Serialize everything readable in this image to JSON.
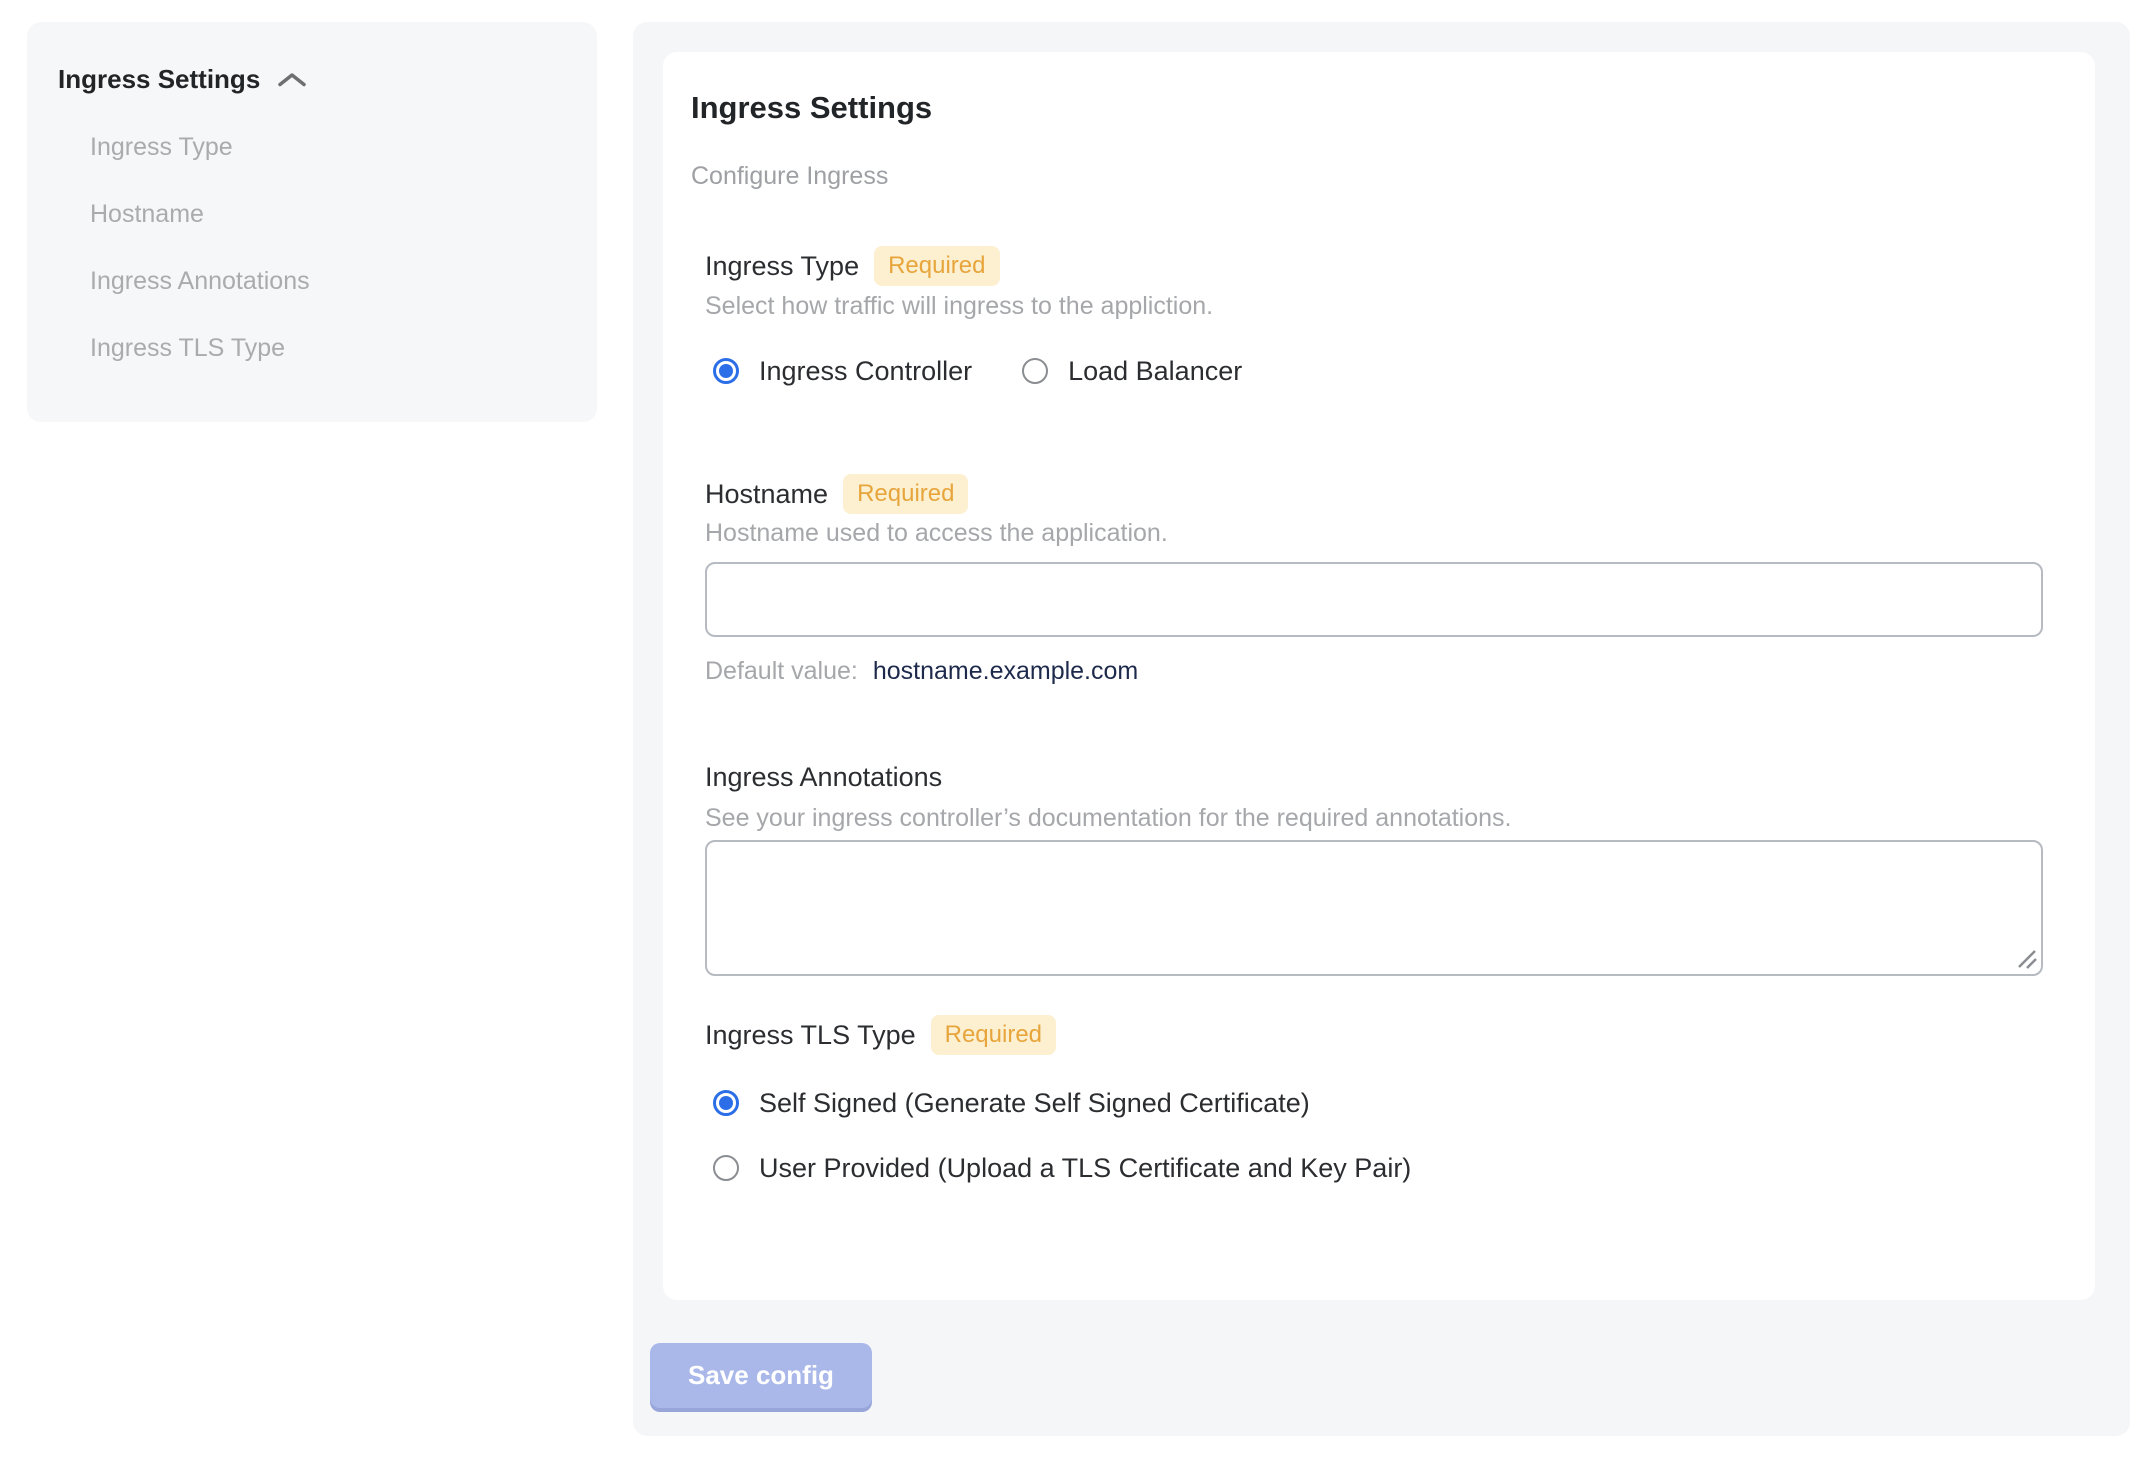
{
  "colors": {
    "accent_blue": "#2b6ee8",
    "badge_background": "#fcf0d1",
    "badge_text": "#e7a53c",
    "save_button_background": "#aab8e9",
    "default_value_text": "#1e2a4b"
  },
  "sidebar": {
    "header": "Ingress Settings",
    "items": [
      "Ingress Type",
      "Hostname",
      "Ingress Annotations",
      "Ingress TLS Type"
    ]
  },
  "main": {
    "title": "Ingress Settings",
    "subtitle": "Configure Ingress",
    "badge": "Required",
    "sections": {
      "ingress_type": {
        "label": "Ingress Type",
        "description": "Select how traffic will ingress to the appliction.",
        "options": [
          {
            "label": "Ingress Controller",
            "selected": true
          },
          {
            "label": "Load Balancer",
            "selected": false
          }
        ]
      },
      "hostname": {
        "label": "Hostname",
        "description": "Hostname used to access the application.",
        "value": "",
        "default_label": "Default value:",
        "default_value": "hostname.example.com"
      },
      "ingress_annotations": {
        "label": "Ingress Annotations",
        "description": "See your ingress controller’s documentation for the required annotations.",
        "value": ""
      },
      "ingress_tls_type": {
        "label": "Ingress TLS Type",
        "options": [
          {
            "label": "Self Signed (Generate Self Signed Certificate)",
            "selected": true
          },
          {
            "label": "User Provided (Upload a TLS Certificate and Key Pair)",
            "selected": false
          }
        ]
      }
    }
  },
  "footer": {
    "save_button": "Save config"
  }
}
